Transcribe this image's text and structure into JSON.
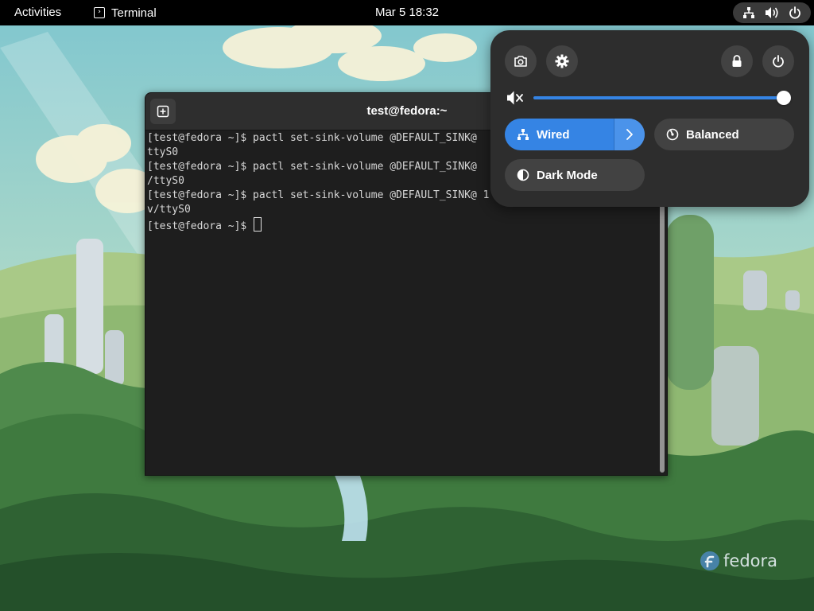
{
  "topbar": {
    "activities_label": "Activities",
    "app_menu_label": "Terminal",
    "app_menu_icon": "terminal-icon",
    "clock": "Mar 5  18:32",
    "status_icons": [
      "network-wired-icon",
      "volume-icon",
      "power-icon"
    ]
  },
  "terminal": {
    "title": "test@fedora:~",
    "new_tab_icon": "new-tab-icon",
    "lines": [
      "[test@fedora ~]$ pactl set-sink-volume @DEFAULT_SINK@",
      "ttyS0",
      "[test@fedora ~]$ pactl set-sink-volume @DEFAULT_SINK@",
      "/ttyS0",
      "[test@fedora ~]$ pactl set-sink-volume @DEFAULT_SINK@ 1",
      "v/ttyS0",
      "[test@fedora ~]$ "
    ],
    "background": "#1e1e1e",
    "foreground": "#d8d8d8"
  },
  "quick_settings": {
    "buttons": [
      "camera-icon",
      "gear-icon",
      "lock-icon",
      "power-icon"
    ],
    "volume": {
      "icon": "volume-muted-icon",
      "level": 1.0
    },
    "tiles": {
      "wired": {
        "label": "Wired",
        "icon": "network-wired-icon",
        "active": true,
        "has_menu": true
      },
      "power_profile": {
        "label": "Balanced",
        "icon": "power-profile-icon",
        "active": false
      },
      "dark_mode": {
        "label": "Dark Mode",
        "icon": "dark-mode-icon",
        "active": false
      }
    },
    "accent_color": "#3584e4",
    "background": "#2d2d2d"
  },
  "wallpaper": {
    "logo_text": "fedora"
  }
}
